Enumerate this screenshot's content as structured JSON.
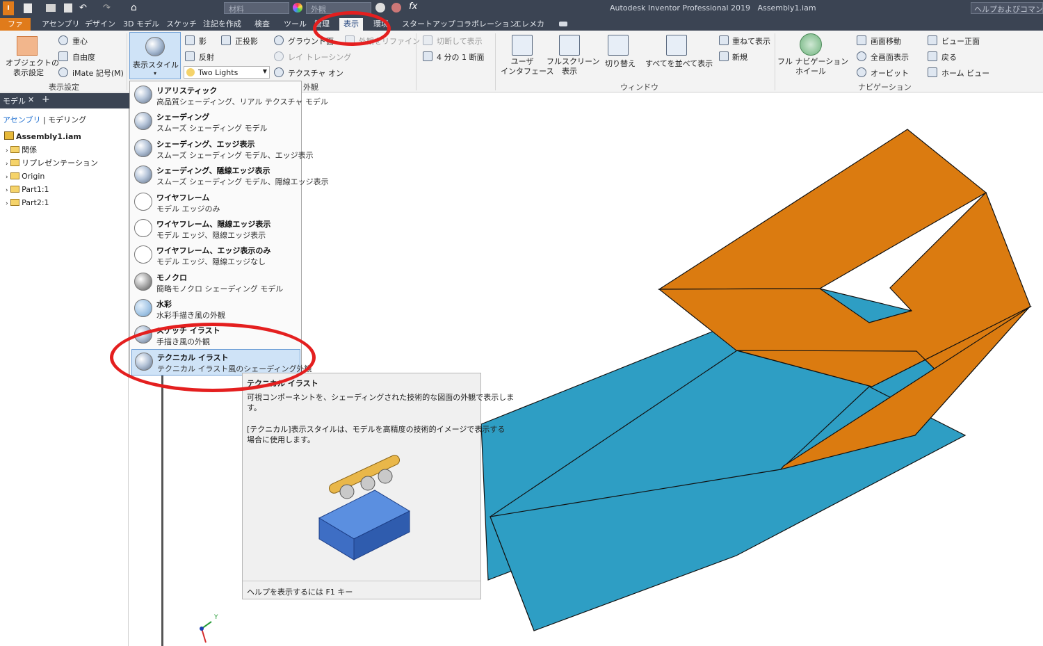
{
  "title_bar": {
    "app_title": "Autodesk Inventor Professional 2019",
    "document": "Assembly1.iam",
    "help_search": "ヘルプおよびコマンドを",
    "material_box": "材料",
    "appearance_box": "外観"
  },
  "tabs": [
    "ファイル",
    "アセンブリ",
    "デザイン",
    "3D モデル",
    "スケッチ",
    "注記を作成",
    "検査",
    "ツール",
    "管理",
    "表示",
    "環境",
    "スタートアップ",
    "コラボレーション",
    "エレメカ"
  ],
  "active_tab": "表示",
  "ribbon": {
    "object_visibility": "オブジェクトの\n表示設定",
    "center_of_gravity": "重心",
    "dof": "自由度",
    "imate": "iMate 記号(M)",
    "panel_visibility": "表示設定",
    "visual_style": "表示スタイル",
    "shadows": "影",
    "orthographic": "正投影",
    "ground_plane": "グラウンド面",
    "reflections": "反射",
    "ray_tracing": "レイ トレーシング",
    "lighting": "Two Lights",
    "textures_on": "テクスチャ オン",
    "appearance_panel": "外観",
    "refine_appearance": "外観をリファイン",
    "half_section_view": "切断して表示",
    "quarter_section": "4 分の 1 断面",
    "user_interface": "ユーザ\nインタフェース",
    "full_screen": "フルスクリーン\n表示",
    "switch": "切り替え",
    "arrange_all": "すべてを並べて表示",
    "cascade": "重ねて表示",
    "new_window": "新規",
    "panel_windows": "ウィンドウ",
    "full_nav_wheel": "フル ナビゲーション\nホイール",
    "pan": "画面移動",
    "zoom_all": "全画面表示",
    "orbit": "オービット",
    "view_face": "ビュー正面",
    "previous": "戻る",
    "home_view": "ホーム ビュー",
    "panel_navigation": "ナビゲーション"
  },
  "browser": {
    "tab_model": "モデル",
    "tab_add": "+",
    "mode_assembly": "アセンブリ",
    "mode_modeling": "モデリング",
    "tree": [
      {
        "label": "Assembly1.iam",
        "bold": true
      },
      {
        "label": "関係"
      },
      {
        "label": "リプレゼンテーション"
      },
      {
        "label": "Origin"
      },
      {
        "label": "Part1:1"
      },
      {
        "label": "Part2:1"
      }
    ]
  },
  "visual_styles": [
    {
      "name": "リアリスティック",
      "desc": "高品質シェーディング、リアル テクスチャ モデル"
    },
    {
      "name": "シェーディング",
      "desc": "スムーズ シェーディング モデル"
    },
    {
      "name": "シェーディング、エッジ表示",
      "desc": "スムーズ シェーディング モデル、エッジ表示"
    },
    {
      "name": "シェーディング、隠線エッジ表示",
      "desc": "スムーズ シェーディング モデル、隠線エッジ表示"
    },
    {
      "name": "ワイヤフレーム",
      "desc": "モデル エッジのみ"
    },
    {
      "name": "ワイヤフレーム、隠線エッジ表示",
      "desc": "モデル エッジ、隠線エッジ表示"
    },
    {
      "name": "ワイヤフレーム、エッジ表示のみ",
      "desc": "モデル エッジ、隠線エッジなし"
    },
    {
      "name": "モノクロ",
      "desc": "簡略モノクロ シェーディング モデル"
    },
    {
      "name": "水彩",
      "desc": "水彩手描き風の外観"
    },
    {
      "name": "スケッチ イラスト",
      "desc": "手描き風の外観"
    },
    {
      "name": "テクニカル イラスト",
      "desc": "テクニカル イラスト風のシェーディング外観"
    }
  ],
  "selected_style": "テクニカル イラスト",
  "tooltip": {
    "title": "テクニカル イラスト",
    "line1": "可視コンポーネントを、シェーディングされた技術的な図面の外観で表示しま",
    "line1b": "す。",
    "line2": "[テクニカル]表示スタイルは、モデルを高精度の技術的イメージで表示する",
    "line2b": "場合に使用します。",
    "footer": "ヘルプを表示するには F1 キー"
  },
  "colors": {
    "part_orange": "#db7b10",
    "part_blue": "#2e9ec4",
    "ribbon_bg": "#f3f3f3",
    "title_bg": "#3b4453",
    "highlight_oval": "#e41f1f"
  },
  "triad_label": "Y"
}
